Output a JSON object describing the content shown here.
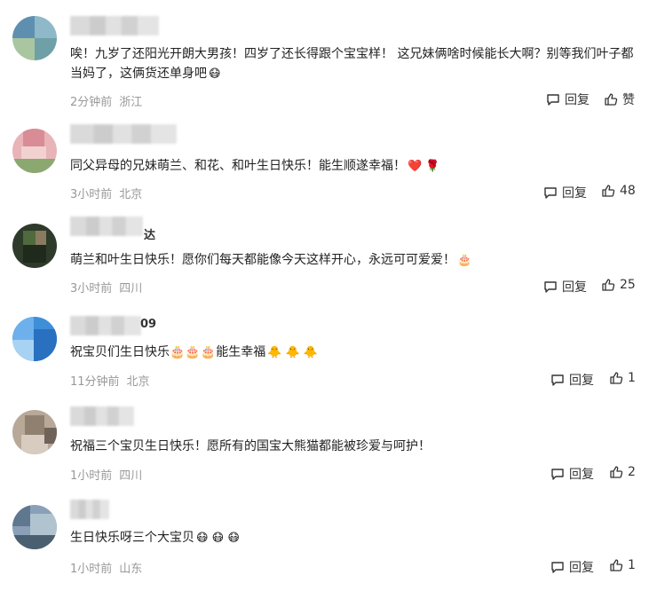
{
  "comments": [
    {
      "text": "唉！九岁了还阳光开朗大男孩！四岁了还长得跟个宝宝样！ 这兄妹俩啥时候能长大啊？别等我们叶子都当妈了，这俩货还单身吧",
      "emoji": "😷",
      "time": "2分钟前",
      "location": "浙江",
      "reply_label": "回复",
      "like_label": "赞",
      "avatar_colors": [
        "#5f8fb0",
        "#8fb8c8",
        "#a9c6a0",
        "#6fa0a8"
      ]
    },
    {
      "text": "同父异母的兄妹萌兰、和花、和叶生日快乐！能生顺遂幸福！",
      "emoji": "❤️ 🌹",
      "time": "3小时前",
      "location": "北京",
      "reply_label": "回复",
      "like_label": "48",
      "avatar_colors": [
        "#e8b4b8",
        "#d98c96",
        "#f2d2d0",
        "#8aa870"
      ]
    },
    {
      "name_tail": "达",
      "text": "萌兰和叶生日快乐！愿你们每天都能像今天这样开心，永远可可爱爱！",
      "emoji": "🎂",
      "time": "3小时前",
      "location": "四川",
      "reply_label": "回复",
      "like_label": "25",
      "avatar_colors": [
        "#2e3a2a",
        "#4f6a3c",
        "#8a7a60",
        "#1f2a1c"
      ]
    },
    {
      "name_tail": "09",
      "text": "祝宝贝们生日快乐🎂🎂🎂能生幸福",
      "emoji": "🐥 🐥 🐥",
      "time": "11分钟前",
      "location": "北京",
      "reply_label": "回复",
      "like_label": "1",
      "avatar_colors": [
        "#3f8ed8",
        "#6db0ec",
        "#2a70c0",
        "#a8d2f4"
      ]
    },
    {
      "text": "祝福三个宝贝生日快乐！愿所有的国宝大熊猫都能被珍爱与呵护！",
      "emoji": "",
      "time": "1小时前",
      "location": "四川",
      "reply_label": "回复",
      "like_label": "2",
      "avatar_colors": [
        "#b8a898",
        "#8f8070",
        "#d8ccc0",
        "#6f6258"
      ]
    },
    {
      "text": "生日快乐呀三个大宝贝",
      "emoji": "😷 😷 😷",
      "time": "1小时前",
      "location": "山东",
      "reply_label": "回复",
      "like_label": "1",
      "avatar_colors": [
        "#8aa0b8",
        "#5f7890",
        "#b0c4d0",
        "#4a5f70"
      ]
    }
  ]
}
